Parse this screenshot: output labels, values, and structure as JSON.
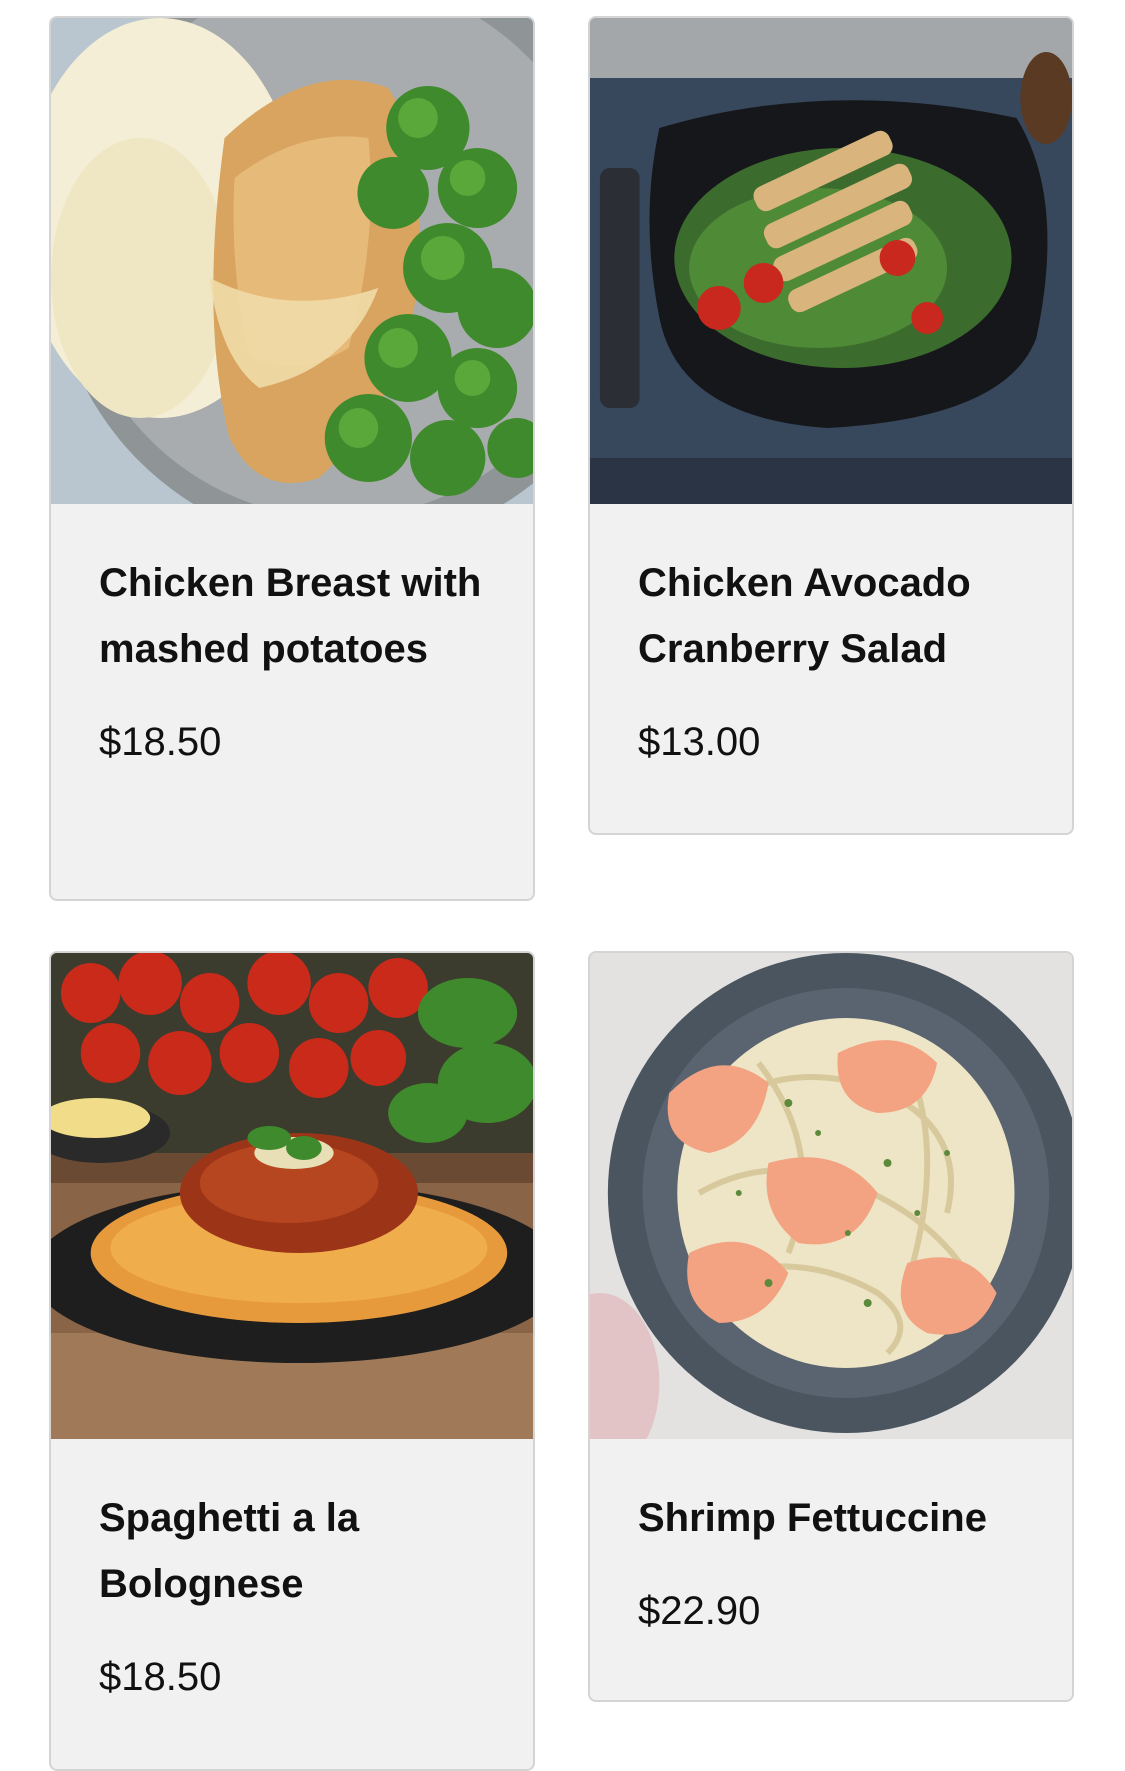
{
  "menu": {
    "items": [
      {
        "name": "Chicken Breast with mashed potatoes",
        "price": "$18.50",
        "image_icon": "chicken-breast-plate-photo"
      },
      {
        "name": "Chicken Avocado Cranberry Salad",
        "price": "$13.00",
        "image_icon": "chicken-salad-photo"
      },
      {
        "name": "Spaghetti a la Bolognese",
        "price": "$18.50",
        "image_icon": "spaghetti-bolognese-photo"
      },
      {
        "name": "Shrimp Fettuccine",
        "price": "$22.90",
        "image_icon": "shrimp-fettuccine-photo"
      }
    ]
  },
  "colors": {
    "card_background": "#f1f1f1",
    "card_border": "#d4d4d4",
    "text": "#111111"
  }
}
